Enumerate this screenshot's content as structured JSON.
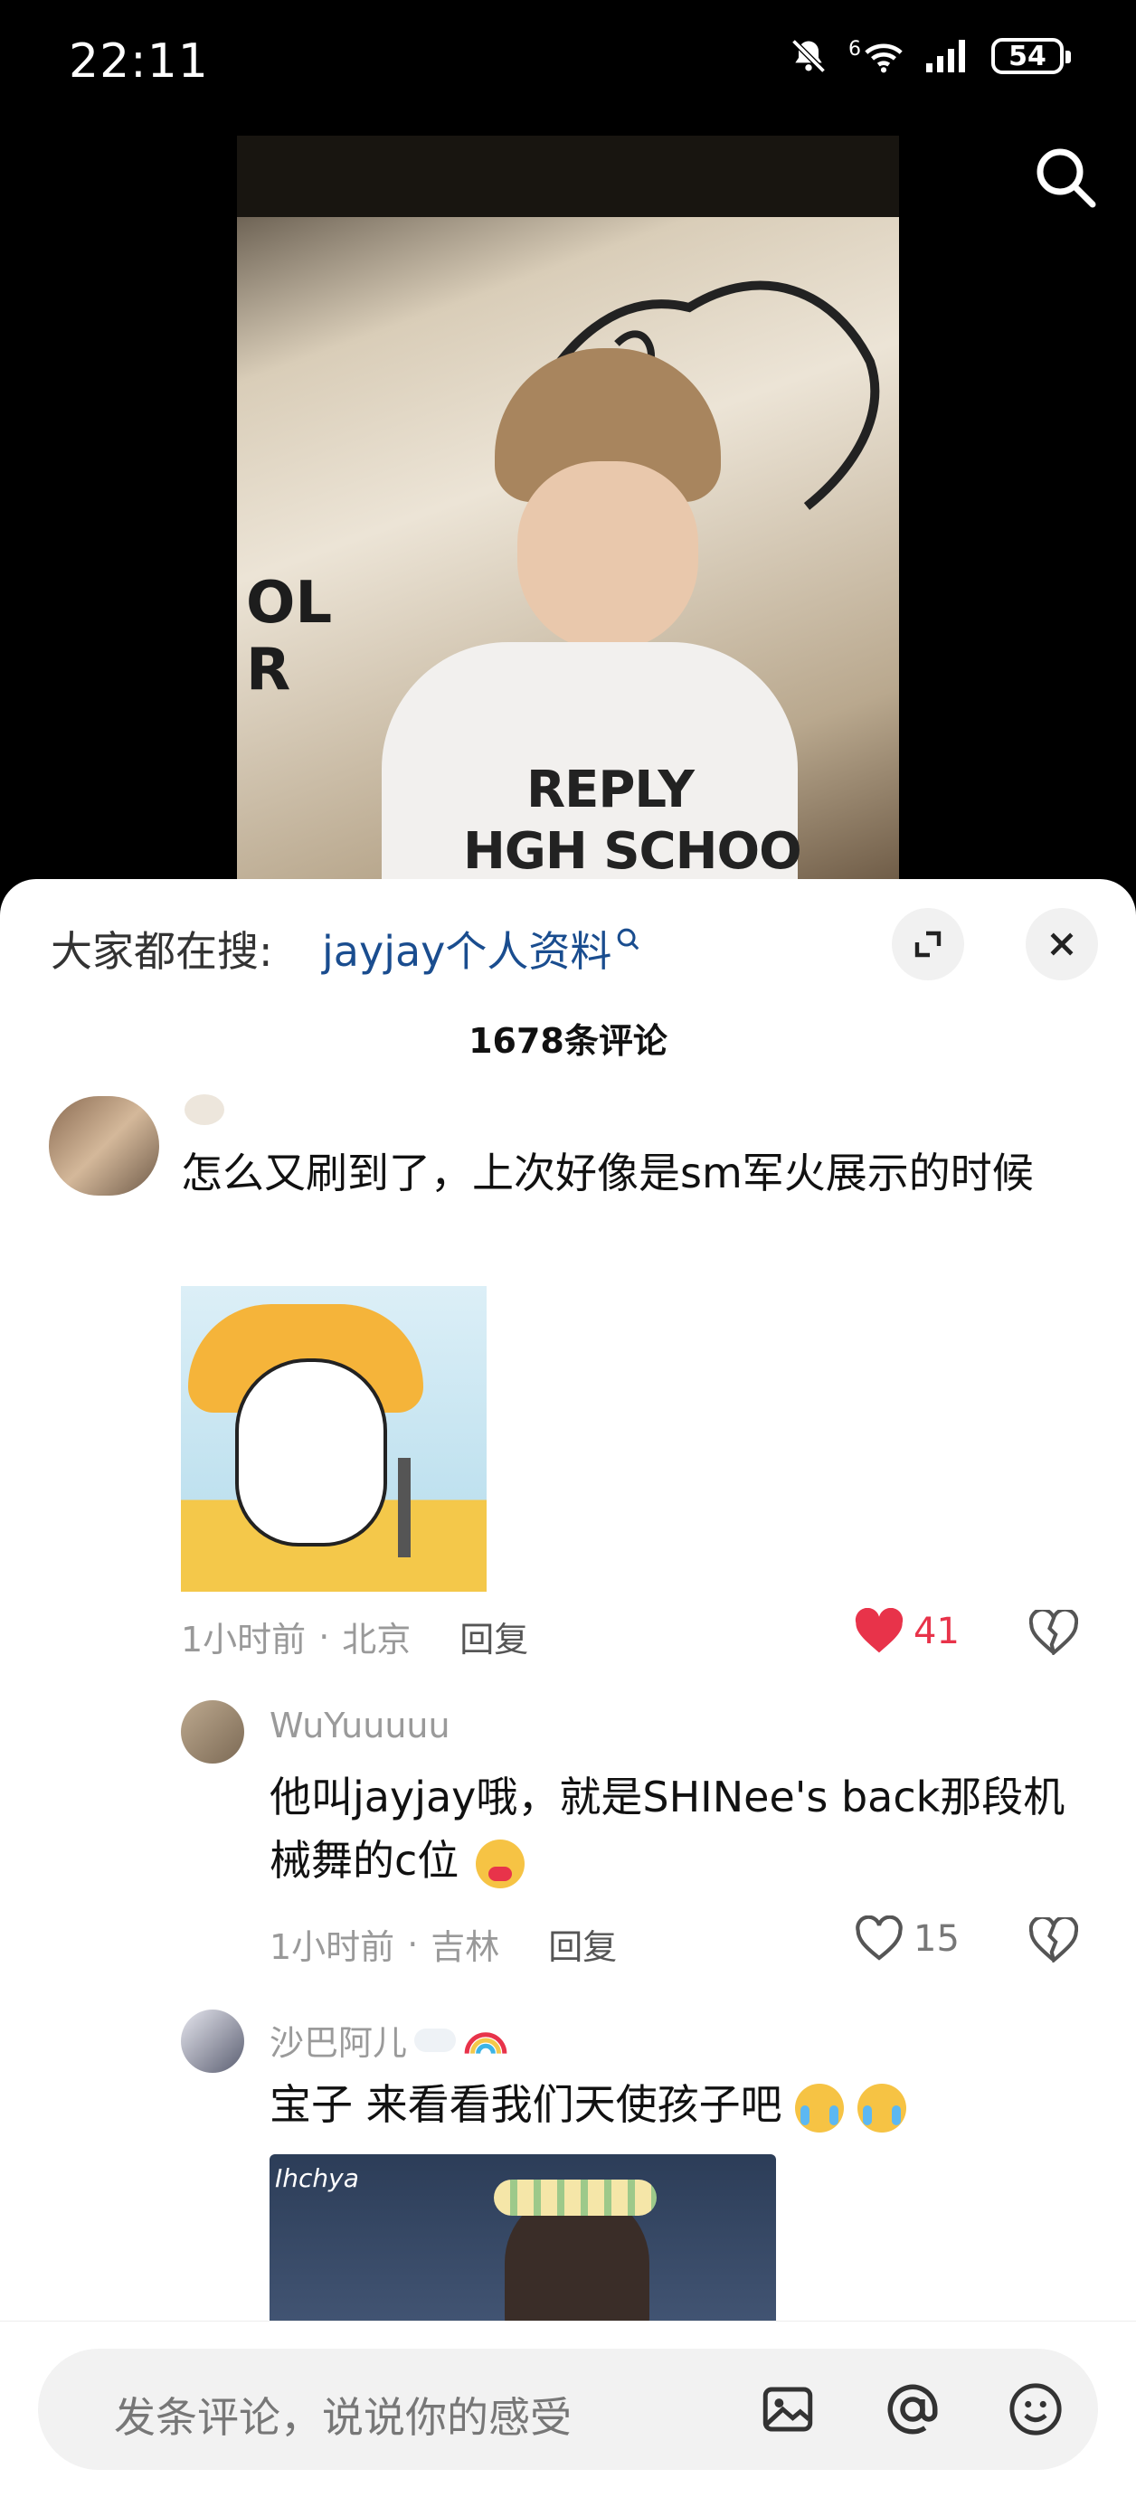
{
  "status_bar": {
    "time": "22:11",
    "battery": "54",
    "network": "6"
  },
  "video": {
    "shirt_text_line1": "REPLY",
    "shirt_text_line2": "HGH SCHOO",
    "wall_text_1": "OL",
    "wall_text_2": "R"
  },
  "sheet": {
    "hot_search_label": "大家都在搜:",
    "hot_search_link": "jayjay个人资料",
    "comment_count": "1678条评论"
  },
  "comments": [
    {
      "text": "怎么又刷到了，上次好像是sm军火展示的时候",
      "time": "1小时前",
      "location": "北京",
      "reply_label": "回复",
      "likes": "41",
      "liked": true
    }
  ],
  "replies": [
    {
      "username": "WuYuuuuu",
      "text": "他叫jayjay哦，就是SHINee's back那段机械舞的c位",
      "time": "1小时前",
      "location": "吉林",
      "reply_label": "回复",
      "likes": "15"
    },
    {
      "username": "沙巴阿儿",
      "text": "宝子 来看看我们天使孩子吧",
      "image_caption": "Ihchya"
    }
  ],
  "input": {
    "placeholder": "发条评论，说说你的感受"
  },
  "colors": {
    "like_red": "#e8334a",
    "link_blue": "#1a4d8f"
  }
}
